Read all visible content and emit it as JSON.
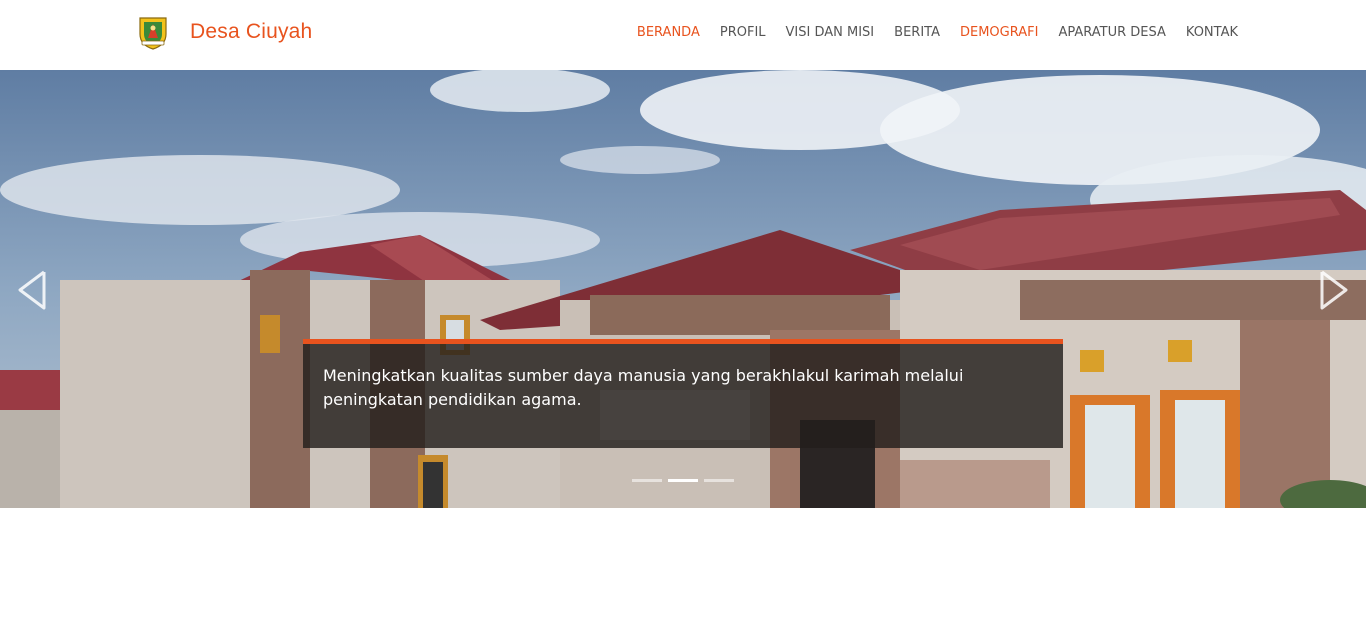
{
  "site": {
    "name": "Desa Ciuyah",
    "logo_icon": "village-emblem-icon"
  },
  "nav": {
    "items": [
      {
        "label": "BERANDA",
        "active": true
      },
      {
        "label": "PROFIL",
        "active": false
      },
      {
        "label": "VISI DAN MISI",
        "active": false
      },
      {
        "label": "BERITA",
        "active": false
      },
      {
        "label": "DEMOGRAFI",
        "active": true
      },
      {
        "label": "APARATUR DESA",
        "active": false
      },
      {
        "label": "KONTAK",
        "active": false
      }
    ]
  },
  "hero": {
    "caption": "Meningkatkan kualitas sumber daya manusia yang berakhlakul karimah melalui peningkatan pendidikan agama.",
    "prev_icon": "chevron-left-icon",
    "next_icon": "chevron-right-icon",
    "slide_count": 3,
    "active_slide": 2
  },
  "colors": {
    "accent": "#e8531e",
    "nav_text": "#555555"
  }
}
